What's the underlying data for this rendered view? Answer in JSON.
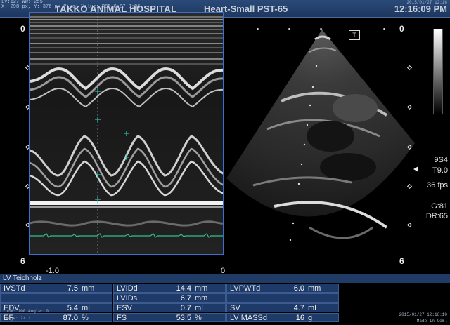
{
  "header": {
    "info_lines": [
      "LV:127 WW: 255",
      "X: 298 px, Y: 376 px  Pixel Value: R85 G:87 B:86"
    ],
    "hospital": "TAKKO ANIMAL HOSPITAL",
    "preset": "Heart-Small PST-65",
    "date": "2015/01/27 12:16",
    "time": "12:16:09 PM"
  },
  "mmode": {
    "depth_top": "0",
    "depth_bottom": "6",
    "time_labels": [
      "-1.0",
      "0"
    ]
  },
  "bmode": {
    "depth_top": "0",
    "depth_bottom": "6",
    "probe_icon": "T",
    "params": [
      "9S4",
      "T9.0",
      "36 fps",
      "G:81",
      "DR:65"
    ]
  },
  "measurements": {
    "title": "LV Teichholz",
    "rows": [
      [
        {
          "label": "IVSTd",
          "value": "7.5",
          "unit": "mm"
        },
        {
          "label": "LVIDd",
          "value": "14.4",
          "unit": "mm"
        },
        {
          "label": "LVPWTd",
          "value": "6.0",
          "unit": "mm"
        }
      ],
      [
        {
          "label": "",
          "value": "",
          "unit": ""
        },
        {
          "label": "LVIDs",
          "value": "6.7",
          "unit": "mm"
        },
        {
          "label": "",
          "value": "",
          "unit": ""
        }
      ],
      [
        {
          "label": "EDV",
          "value": "5.4",
          "unit": "mL"
        },
        {
          "label": "ESV",
          "value": "0.7",
          "unit": "mL"
        },
        {
          "label": "SV",
          "value": "4.7",
          "unit": "mL"
        }
      ],
      [
        {
          "label": "EF",
          "value": "87.0",
          "unit": "%"
        },
        {
          "label": "FS",
          "value": "53.5",
          "unit": "%"
        },
        {
          "label": "LV MASSd",
          "value": "16",
          "unit": "g"
        }
      ]
    ],
    "footer_left": [
      "Zoom: 100  Angle: 0",
      "Image: 2/11"
    ],
    "footer_right": [
      "2015/01/27 12:16:10",
      "Made in Ooml"
    ]
  }
}
